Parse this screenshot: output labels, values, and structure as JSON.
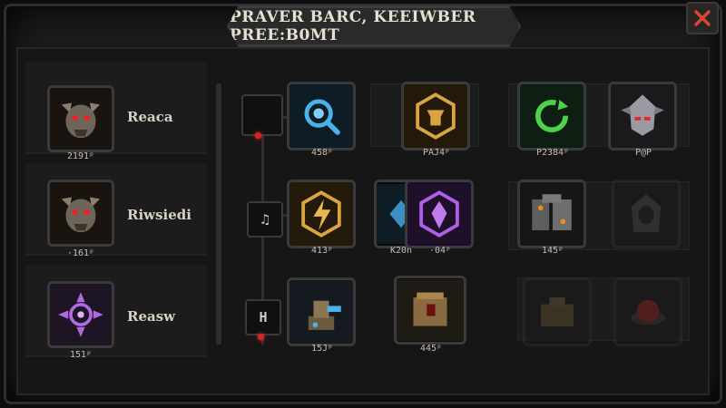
{
  "title": "PRAVER BARC, KEEIWBER PREE:B0MT",
  "close_label": "✕",
  "classes": [
    {
      "name": "Reaca",
      "cost": "2191ᵖ",
      "icon": "demon-skull-icon"
    },
    {
      "name": "Riwsiedi",
      "cost": "·161ᵖ",
      "icon": "demon-skull-icon"
    },
    {
      "name": "Reasw",
      "cost": "151ᵖ",
      "icon": "compass-rune-icon"
    }
  ],
  "side_nodes": [
    {
      "label": ""
    },
    {
      "label": "♫"
    },
    {
      "label": "H"
    }
  ],
  "skills": [
    {
      "cost": "458ᵖ",
      "icon": "blue-search-rune-icon",
      "locked": false
    },
    {
      "cost": "PAJ4ᵖ",
      "icon": "gold-anvil-rune-icon",
      "locked": false
    },
    {
      "cost": "P2384ᵖ",
      "icon": "green-cycle-rune-icon",
      "locked": false
    },
    {
      "cost": "P@P",
      "icon": "steel-helmet-icon",
      "locked": false
    },
    {
      "cost": "413ᵖ",
      "icon": "gold-lightning-rune-icon",
      "locked": false
    },
    {
      "cost": "K20h",
      "icon": "blue-crystal-rune-icon",
      "locked": false
    },
    {
      "cost": "·04ᵖ",
      "icon": "purple-crystal-rune-icon",
      "locked": false
    },
    {
      "cost": "145ᵖ",
      "icon": "stone-armor-icon",
      "locked": false
    },
    {
      "cost": "",
      "icon": "hooded-figure-icon",
      "locked": true
    },
    {
      "cost": "15Jᵖ",
      "icon": "cannon-turret-icon",
      "locked": false
    },
    {
      "cost": "445ᵖ",
      "icon": "bronze-cube-icon",
      "locked": false
    },
    {
      "cost": "",
      "icon": "wooden-crate-icon",
      "locked": true
    },
    {
      "cost": "",
      "icon": "red-mine-icon",
      "locked": true
    }
  ]
}
